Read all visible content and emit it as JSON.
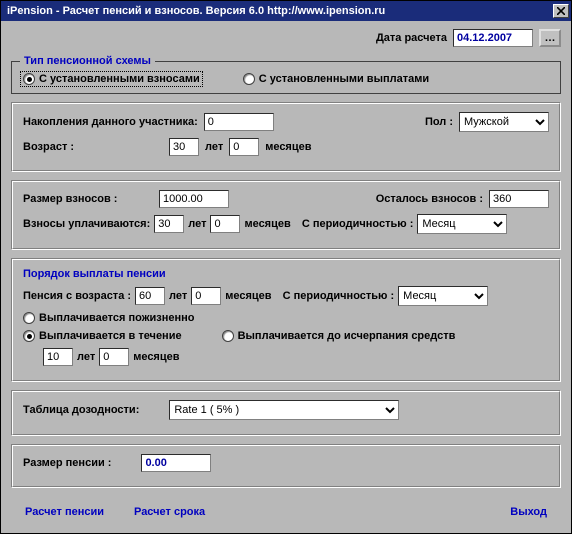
{
  "titlebar": {
    "text": "iPension   -   Расчет пенсий и взносов.    Версия 6.0    http://www.ipension.ru"
  },
  "calc_date": {
    "label": "Дата расчета",
    "value": "04.12.2007"
  },
  "scheme": {
    "legend": "Тип  пенсионной схемы",
    "option_contrib": "С установленными взносами",
    "option_payout": "С установленными выплатами"
  },
  "participant": {
    "accum_label": "Накопления данного участника:",
    "accum_value": "0",
    "gender_label": "Пол :",
    "gender_value": "Мужской",
    "age_label": "Возраст :",
    "age_years": "30",
    "years_unit": "лет",
    "age_months": "0",
    "months_unit": "месяцев"
  },
  "contrib": {
    "size_label": "Размер взносов :",
    "size_value": "1000.00",
    "left_label": "Осталось взносов :",
    "left_value": "360",
    "paid_label": "Взносы уплачиваются:",
    "paid_years": "30",
    "years_unit": "лет",
    "paid_months": "0",
    "months_unit": "месяцев",
    "period_label": "С периодичностью :",
    "period_value": "Месяц"
  },
  "payout": {
    "header": "Порядок выплаты пенсии",
    "from_age_label": "Пенсия с возраста :",
    "from_years": "60",
    "years_unit": "лет",
    "from_months": "0",
    "months_unit": "месяцев",
    "period_label": "С периодичностью :",
    "period_value": "Месяц",
    "opt_life": "Выплачивается пожизненно",
    "opt_term": "Выплачивается в течение",
    "opt_exhaust": "Выплачивается до исчерпания средств",
    "term_years": "10",
    "term_months": "0"
  },
  "rate": {
    "label": "Таблица дозодности:",
    "value": "Rate 1  ( 5% )"
  },
  "result": {
    "label": "Размер пенсии :",
    "value": "0.00"
  },
  "actions": {
    "calc_pension": "Расчет пенсии",
    "calc_term": "Расчет срока",
    "exit": "Выход"
  }
}
